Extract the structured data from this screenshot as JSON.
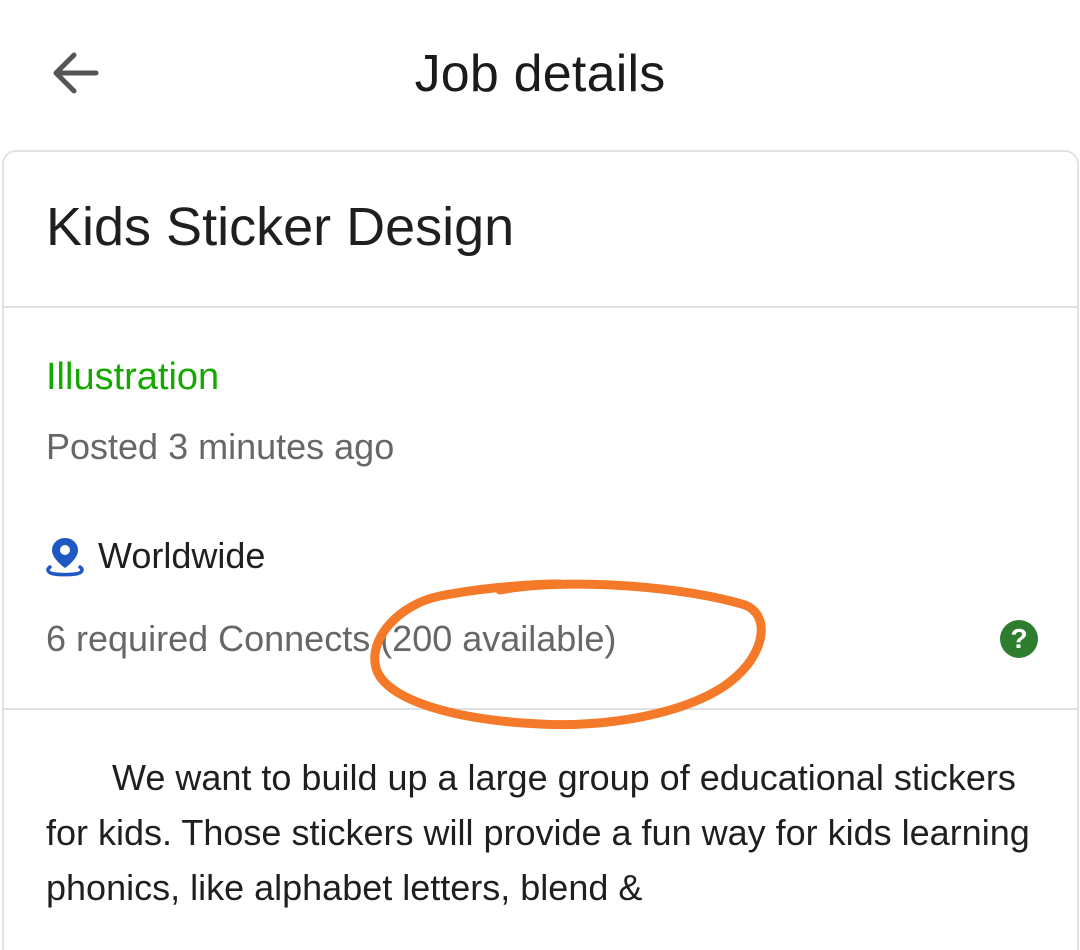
{
  "header": {
    "title": "Job details",
    "back_icon": "arrow-left-icon"
  },
  "job": {
    "title": "Kids Sticker Design",
    "category": "Illustration",
    "posted": "Posted 3 minutes ago",
    "location": "Worldwide",
    "location_icon": "location-pin-icon",
    "connects": "6 required Connects (200 available)",
    "help_icon": "question-mark-icon",
    "description": "We want to build up a large group of educational stickers for kids. Those stickers will provide a fun way for kids learning phonics, like alphabet letters, blend &"
  },
  "colors": {
    "category_green": "#14a800",
    "help_green": "#2e7d2e",
    "location_blue": "#1f57c3",
    "annotation_orange": "#f47a2a"
  }
}
